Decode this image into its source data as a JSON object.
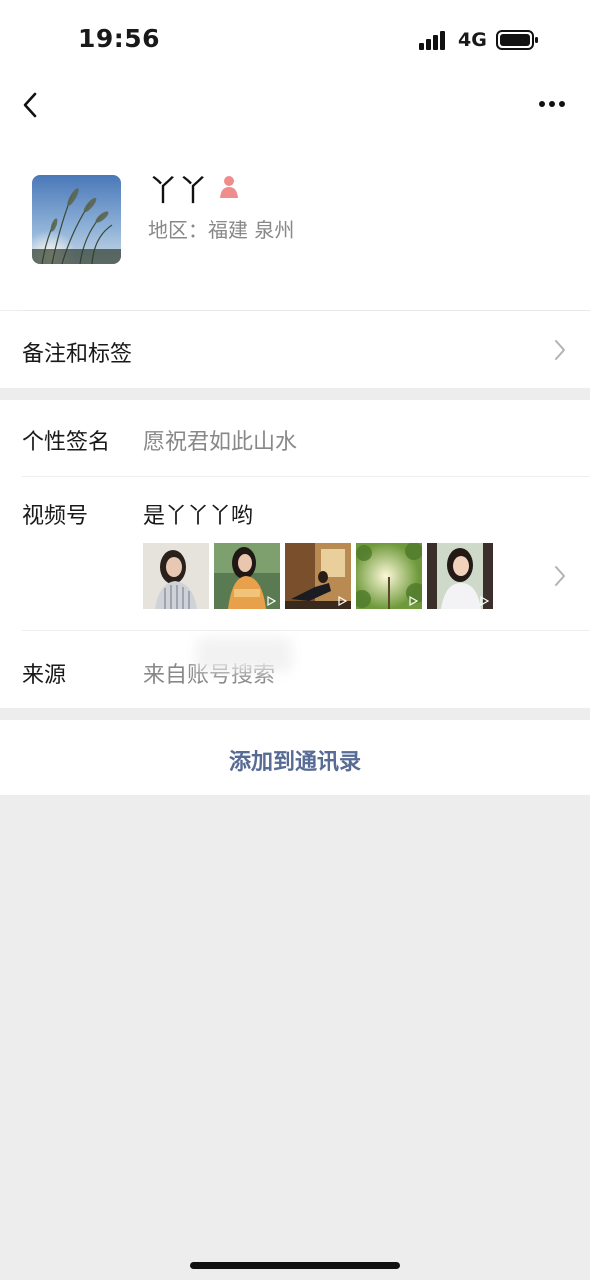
{
  "status_bar": {
    "time": "19:56",
    "network": "4G",
    "icons": [
      "signal-icon",
      "battery-icon"
    ]
  },
  "nav": {
    "icons": [
      "back-icon",
      "more-icon"
    ]
  },
  "profile": {
    "nickname": "丫丫",
    "gender_icon": "female-icon",
    "region": "地区：福建 泉州"
  },
  "rows": {
    "remarks_label": "备注和标签",
    "signature_label": "个性签名",
    "signature_value": "愿祝君如此山水",
    "channels_label": "视频号",
    "channels_name": "是丫丫丫哟",
    "channel_thumbnails": [
      "woman in striped shirt",
      "woman in orange top",
      "woman sitting in room",
      "tree sunlight",
      "woman by window"
    ],
    "source_label": "来源",
    "source_value": "来自账号搜索"
  },
  "actions": {
    "add_contact": "添加到通讯录"
  },
  "colors": {
    "link": "#576b95",
    "background": "#ededed",
    "card": "#ffffff",
    "secondary_text": "#888888"
  }
}
